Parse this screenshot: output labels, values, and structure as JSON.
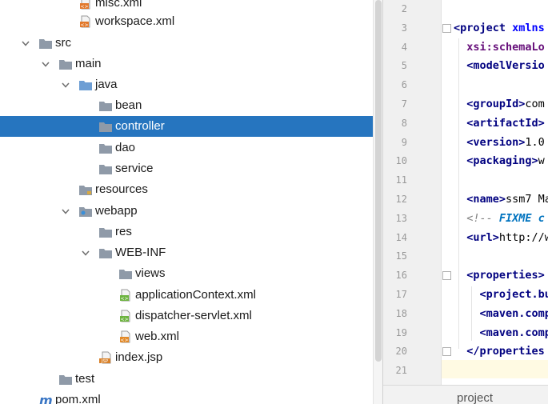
{
  "tree": {
    "items": [
      {
        "label": "misc.xml",
        "icon": "xml-file-icon",
        "depth": 3,
        "expanded": null,
        "selected": false
      },
      {
        "label": "workspace.xml",
        "icon": "xml-file-icon",
        "depth": 3,
        "expanded": null,
        "selected": false
      },
      {
        "label": "src",
        "icon": "folder-icon",
        "depth": 1,
        "expanded": true,
        "selected": false
      },
      {
        "label": "main",
        "icon": "folder-icon",
        "depth": 2,
        "expanded": true,
        "selected": false
      },
      {
        "label": "java",
        "icon": "source-folder-icon",
        "depth": 3,
        "expanded": true,
        "selected": false
      },
      {
        "label": "bean",
        "icon": "package-icon",
        "depth": 4,
        "expanded": null,
        "selected": false
      },
      {
        "label": "controller",
        "icon": "package-icon",
        "depth": 4,
        "expanded": null,
        "selected": true
      },
      {
        "label": "dao",
        "icon": "package-icon",
        "depth": 4,
        "expanded": null,
        "selected": false
      },
      {
        "label": "service",
        "icon": "package-icon",
        "depth": 4,
        "expanded": null,
        "selected": false
      },
      {
        "label": "resources",
        "icon": "resources-folder-icon",
        "depth": 3,
        "expanded": null,
        "selected": false
      },
      {
        "label": "webapp",
        "icon": "web-folder-icon",
        "depth": 3,
        "expanded": true,
        "selected": false
      },
      {
        "label": "res",
        "icon": "folder-icon",
        "depth": 4,
        "expanded": null,
        "selected": false
      },
      {
        "label": "WEB-INF",
        "icon": "folder-icon",
        "depth": 4,
        "expanded": true,
        "selected": false
      },
      {
        "label": "views",
        "icon": "folder-icon",
        "depth": 5,
        "expanded": null,
        "selected": false
      },
      {
        "label": "applicationContext.xml",
        "icon": "spring-xml-file-icon",
        "depth": 5,
        "expanded": null,
        "selected": false
      },
      {
        "label": "dispatcher-servlet.xml",
        "icon": "spring-xml-file-icon",
        "depth": 5,
        "expanded": null,
        "selected": false
      },
      {
        "label": "web.xml",
        "icon": "web-xml-file-icon",
        "depth": 5,
        "expanded": null,
        "selected": false
      },
      {
        "label": "index.jsp",
        "icon": "jsp-file-icon",
        "depth": 4,
        "expanded": null,
        "selected": false
      },
      {
        "label": "test",
        "icon": "folder-icon",
        "depth": 2,
        "expanded": null,
        "selected": false
      },
      {
        "label": "pom.xml",
        "icon": "maven-file-icon",
        "depth": 1,
        "expanded": null,
        "selected": false
      }
    ]
  },
  "editor": {
    "lines": [
      {
        "n": "2",
        "segs": []
      },
      {
        "n": "3",
        "segs": [
          {
            "c": "tag",
            "t": "<project "
          },
          {
            "c": "attr",
            "t": "xmlns"
          }
        ]
      },
      {
        "n": "4",
        "segs": [
          {
            "c": "plain",
            "t": "  "
          },
          {
            "c": "attrb",
            "t": "xsi:schemaLo"
          }
        ]
      },
      {
        "n": "5",
        "segs": [
          {
            "c": "plain",
            "t": "  "
          },
          {
            "c": "tag",
            "t": "<modelVersio"
          }
        ]
      },
      {
        "n": "6",
        "segs": []
      },
      {
        "n": "7",
        "segs": [
          {
            "c": "plain",
            "t": "  "
          },
          {
            "c": "tag",
            "t": "<groupId>"
          },
          {
            "c": "plain",
            "t": "com"
          }
        ]
      },
      {
        "n": "8",
        "segs": [
          {
            "c": "plain",
            "t": "  "
          },
          {
            "c": "tag",
            "t": "<artifactId>"
          }
        ]
      },
      {
        "n": "9",
        "segs": [
          {
            "c": "plain",
            "t": "  "
          },
          {
            "c": "tag",
            "t": "<version>"
          },
          {
            "c": "plain",
            "t": "1.0"
          }
        ]
      },
      {
        "n": "10",
        "segs": [
          {
            "c": "plain",
            "t": "  "
          },
          {
            "c": "tag",
            "t": "<packaging>"
          },
          {
            "c": "plain",
            "t": "w"
          }
        ]
      },
      {
        "n": "11",
        "segs": []
      },
      {
        "n": "12",
        "segs": [
          {
            "c": "plain",
            "t": "  "
          },
          {
            "c": "tag",
            "t": "<name>"
          },
          {
            "c": "plain",
            "t": "ssm7 Ma"
          }
        ]
      },
      {
        "n": "13",
        "segs": [
          {
            "c": "plain",
            "t": "  "
          },
          {
            "c": "cmt",
            "t": "<!-- "
          },
          {
            "c": "todo",
            "t": "FIXME c"
          }
        ]
      },
      {
        "n": "14",
        "segs": [
          {
            "c": "plain",
            "t": "  "
          },
          {
            "c": "tag",
            "t": "<url>"
          },
          {
            "c": "plain",
            "t": "http://w"
          }
        ]
      },
      {
        "n": "15",
        "segs": []
      },
      {
        "n": "16",
        "segs": [
          {
            "c": "plain",
            "t": "  "
          },
          {
            "c": "tag",
            "t": "<properties>"
          }
        ]
      },
      {
        "n": "17",
        "segs": [
          {
            "c": "plain",
            "t": "    "
          },
          {
            "c": "tag",
            "t": "<project.bu"
          }
        ]
      },
      {
        "n": "18",
        "segs": [
          {
            "c": "plain",
            "t": "    "
          },
          {
            "c": "tag",
            "t": "<maven.comp"
          }
        ]
      },
      {
        "n": "19",
        "segs": [
          {
            "c": "plain",
            "t": "    "
          },
          {
            "c": "tag",
            "t": "<maven.comp"
          }
        ]
      },
      {
        "n": "20",
        "segs": [
          {
            "c": "plain",
            "t": "  "
          },
          {
            "c": "tag",
            "t": "</properties"
          }
        ]
      },
      {
        "n": "21",
        "segs": []
      }
    ],
    "footer_label": "project"
  },
  "colors": {
    "selection": "#2675bf",
    "folder": "#8f9aa8",
    "tag": "#000080",
    "attribute": "#0000ff"
  }
}
